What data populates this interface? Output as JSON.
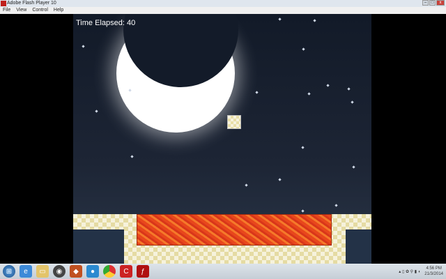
{
  "window": {
    "title": "Adobe Flash Player 10",
    "menu": [
      "File",
      "View",
      "Control",
      "Help"
    ]
  },
  "game": {
    "timer_label": "Time Elapsed: 40"
  },
  "taskbar": {
    "apps": [
      "start",
      "internet-explorer",
      "file-explorer",
      "media-player",
      "app-4",
      "app-5",
      "chrome",
      "app-c",
      "flash-player"
    ],
    "time": "4:56 PM",
    "date": "21/3/2014"
  }
}
